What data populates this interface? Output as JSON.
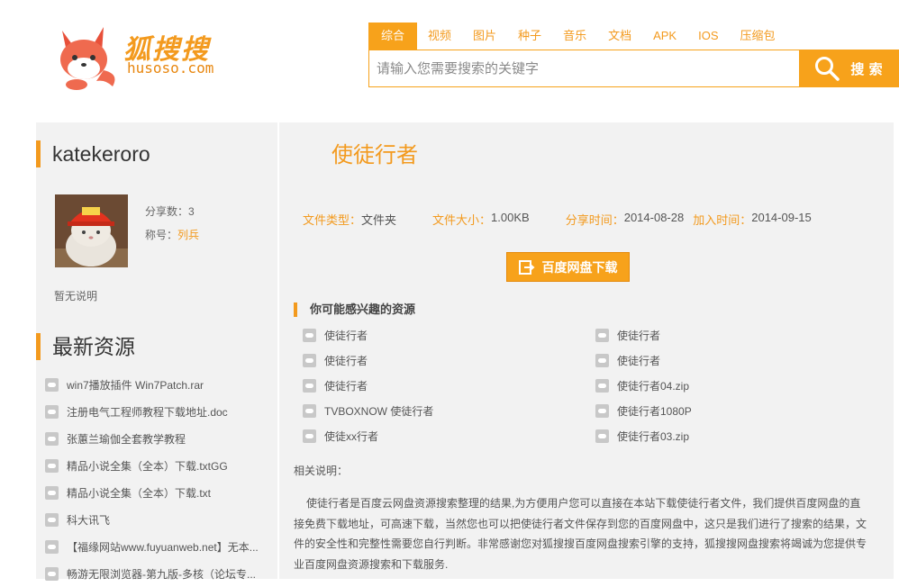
{
  "brand": {
    "title": "狐搜搜",
    "domain": "husoso.com"
  },
  "tabs": [
    {
      "label": "综合",
      "active": true
    },
    {
      "label": "视频"
    },
    {
      "label": "图片"
    },
    {
      "label": "种子"
    },
    {
      "label": "音乐"
    },
    {
      "label": "文档"
    },
    {
      "label": "APK"
    },
    {
      "label": "IOS"
    },
    {
      "label": "压缩包"
    }
  ],
  "search": {
    "placeholder": "请输入您需要搜索的关键字",
    "button_label": "搜 索"
  },
  "user": {
    "name": "katekeroro",
    "share_count_label": "分享数：3",
    "rank_label": "称号：",
    "rank_value": "列兵",
    "description": "暂无说明"
  },
  "latest": {
    "title": "最新资源",
    "items": [
      "win7播放插件 Win7Patch.rar",
      "注册电气工程师教程下载地址.doc",
      "张蕙兰瑜伽全套教学教程",
      "精品小说全集（全本）下载.txtGG",
      "精品小说全集（全本）下载.txt",
      "科大讯飞",
      "【福缘网站www.fuyuanweb.net】无本...",
      "畅游无限浏览器-第九版-多核（论坛专..."
    ]
  },
  "file": {
    "title": "使徒行者",
    "type_label": "文件类型：",
    "type_value": "文件夹",
    "size_label": "文件大小：",
    "size_value": "1.00KB",
    "share_time_label": "分享时间：",
    "share_time_value": "2014-08-28",
    "add_time_label": "加入时间：",
    "add_time_value": "2014-09-15",
    "download_label": "百度网盘下载"
  },
  "related": {
    "title": "你可能感兴趣的资源",
    "items": [
      "使徒行者",
      "使徒行者",
      "使徒行者",
      "使徒行者",
      "使徒行者",
      "使徒行者04.zip",
      "TVBOXNOW 使徒行者",
      "使徒行者1080P",
      "使徒xx行者",
      "使徒行者03.zip"
    ]
  },
  "description": {
    "label": "相关说明：",
    "text": "使徒行者是百度云网盘资源搜索整理的结果,为方便用户您可以直接在本站下载使徒行者文件，我们提供百度网盘的直接免费下载地址，可高速下载，当然您也可以把使徒行者文件保存到您的百度网盘中，这只是我们进行了搜索的结果，文件的安全性和完整性需要您自行判断。非常感谢您对狐搜搜百度网盘搜索引擎的支持，狐搜搜网盘搜索将竭诚为您提供专业百度网盘资源搜索和下载服务."
  },
  "colors": {
    "accent": "#f7a21b",
    "panel": "#f2f2f2"
  }
}
